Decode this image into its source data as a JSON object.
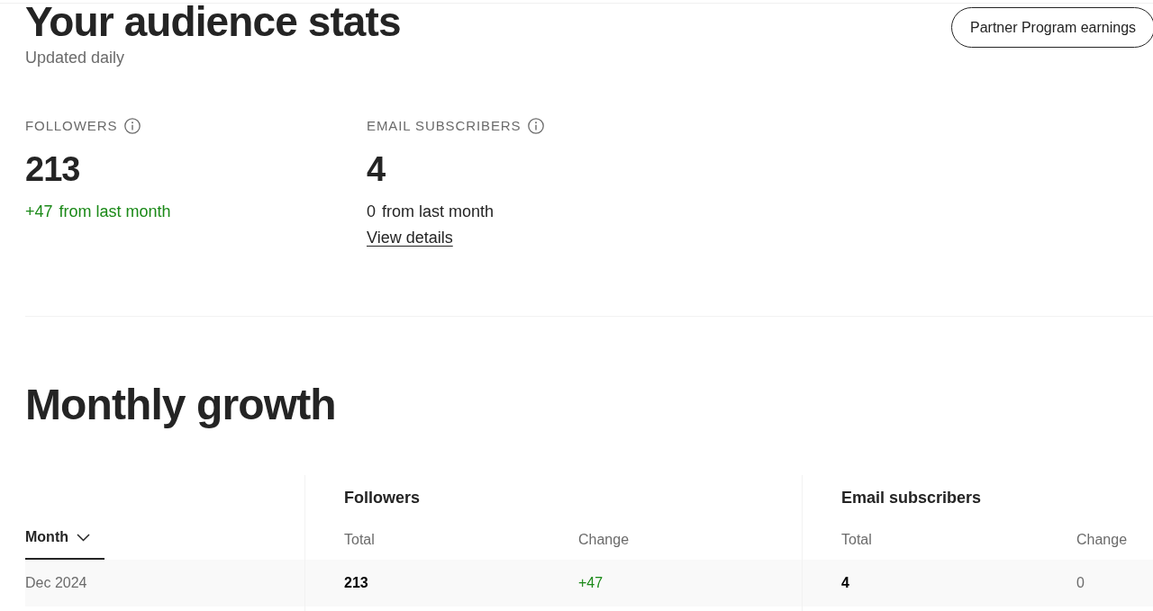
{
  "header": {
    "title": "Your audience stats",
    "subtitle": "Updated daily",
    "button": "Partner Program earnings"
  },
  "stats": [
    {
      "label": "FOLLOWERS",
      "value": "213",
      "change": "+47",
      "change_text": "from last month",
      "positive": true
    },
    {
      "label": "EMAIL SUBSCRIBERS",
      "value": "4",
      "change": "0",
      "change_text": "from last month",
      "positive": false,
      "link": "View details"
    }
  ],
  "growth": {
    "title": "Monthly growth",
    "table": {
      "month_column": {
        "label": "Month",
        "sorted": true
      },
      "groups": [
        {
          "label": "Followers",
          "columns": [
            "Total",
            "Change"
          ]
        },
        {
          "label": "Email subscribers",
          "columns": [
            "Total",
            "Change"
          ]
        }
      ],
      "rows": [
        {
          "month": "Dec 2024",
          "values": [
            {
              "text": "213",
              "kind": "total"
            },
            {
              "text": "+47",
              "kind": "change",
              "positive": true
            },
            {
              "text": "4",
              "kind": "total"
            },
            {
              "text": "0",
              "kind": "change",
              "positive": false
            }
          ]
        }
      ]
    }
  }
}
